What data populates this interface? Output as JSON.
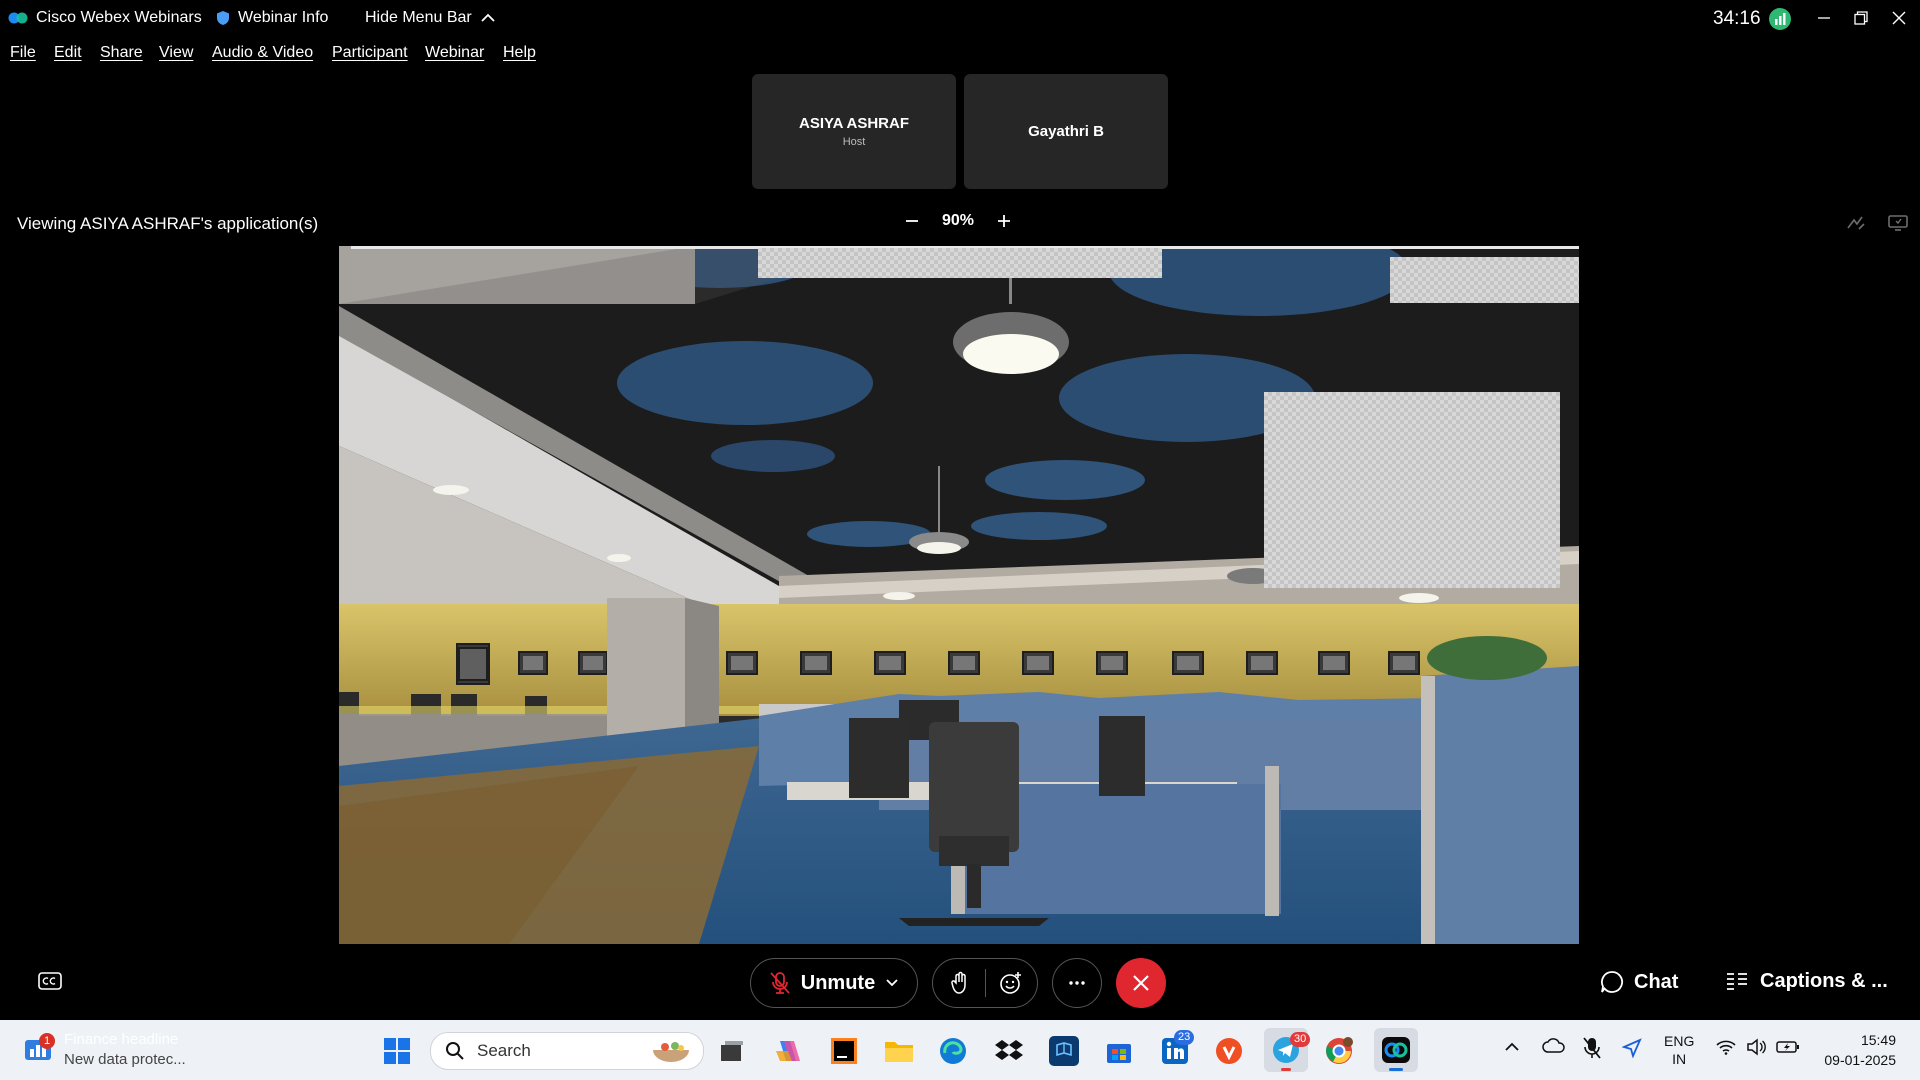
{
  "titlebar": {
    "app_title": "Cisco Webex Webinars",
    "webinar_info": "Webinar Info",
    "hide_menu_bar": "Hide Menu Bar",
    "timer": "34:16"
  },
  "menu": [
    "File",
    "Edit",
    "Share",
    "View",
    "Audio & Video",
    "Participant",
    "Webinar",
    "Help"
  ],
  "participants": [
    {
      "name": "ASIYA ASHRAF",
      "role": "Host"
    },
    {
      "name": "Gayathri B",
      "role": ""
    }
  ],
  "share": {
    "viewing_text": "Viewing ASIYA ASHRAF's application(s)",
    "zoom_level": "90%"
  },
  "controls": {
    "unmute": "Unmute",
    "chat": "Chat",
    "captions": "Captions & ..."
  },
  "taskbar": {
    "notification_title": "Finance headline",
    "notification_sub": "New data protec...",
    "notification_badge": "1",
    "search_placeholder": "Search",
    "linkedin_badge": "23",
    "telegram_badge": "30",
    "language_top": "ENG",
    "language_bottom": "IN",
    "time": "15:49",
    "date": "09-01-2025"
  },
  "colors": {
    "end_call": "#e0272f",
    "timer_icon": "#2eb872",
    "wall": "#b9a451",
    "carpet": "#2f5a85",
    "ceiling": "#1c1c1c"
  }
}
